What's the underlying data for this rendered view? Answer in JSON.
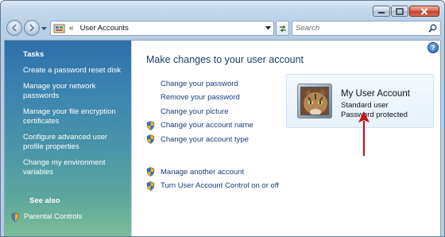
{
  "window": {
    "caption_icons": [
      "minimize-icon",
      "maximize-icon",
      "close-icon"
    ]
  },
  "navigation": {
    "address_separator": "«",
    "address_text": "User Accounts",
    "search_placeholder": "Search"
  },
  "sidebar": {
    "tasks_heading": "Tasks",
    "tasks": [
      {
        "label": "Create a password reset disk"
      },
      {
        "label": "Manage your network passwords"
      },
      {
        "label": "Manage your file encryption certificates"
      },
      {
        "label": "Configure advanced user profile properties"
      },
      {
        "label": "Change my environment variables"
      }
    ],
    "see_also_heading": "See also",
    "see_also": [
      {
        "label": "Parental Controls",
        "icon": "parental-controls-icon"
      }
    ]
  },
  "main": {
    "title": "Make changes to your user account",
    "help_label": "?",
    "tasks": [
      {
        "label": "Change your password",
        "shield": false
      },
      {
        "label": "Remove your password",
        "shield": false
      },
      {
        "label": "Change your picture",
        "shield": false
      },
      {
        "label": "Change your account name",
        "shield": true
      },
      {
        "label": "Change your account type",
        "shield": true
      }
    ],
    "tasks2": [
      {
        "label": "Manage another account",
        "shield": true
      },
      {
        "label": "Turn User Account Control on or off",
        "shield": true
      }
    ]
  },
  "account": {
    "name": "My User Account",
    "type": "Standard user",
    "password_status": "Password protected",
    "picture": "cat-avatar"
  },
  "colors": {
    "sidebar_top": "#2e6fa8",
    "sidebar_bottom": "#7fbe9a",
    "link": "#1a3b83",
    "title": "#1c3c6e",
    "annotation_arrow": "#c0141b"
  }
}
